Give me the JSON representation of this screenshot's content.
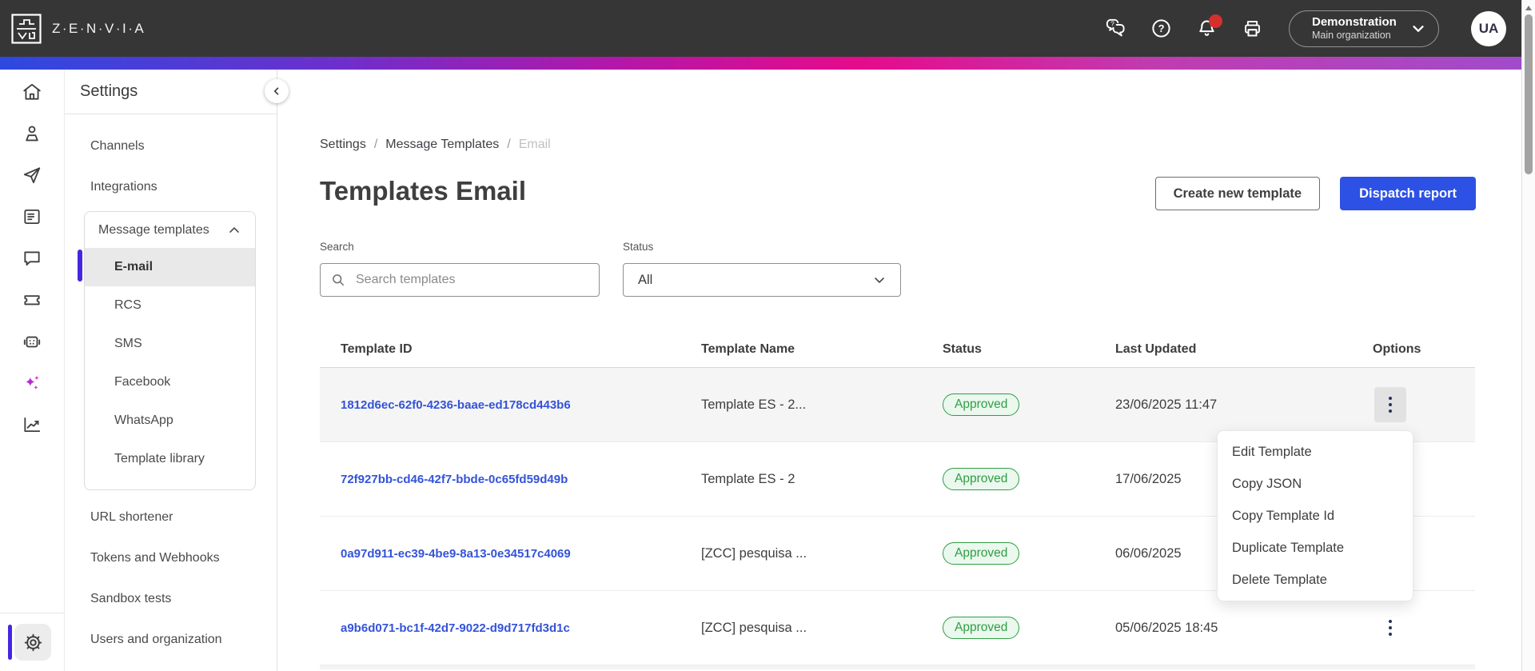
{
  "topbar": {
    "brand": "Z·E·N·V·I·A",
    "org_name": "Demonstration",
    "org_sub": "Main organization",
    "avatar_initials": "UA"
  },
  "sidebar": {
    "title": "Settings",
    "items_before": [
      "Channels",
      "Integrations"
    ],
    "group": {
      "label": "Message templates",
      "children": [
        "E-mail",
        "RCS",
        "SMS",
        "Facebook",
        "WhatsApp",
        "Template library"
      ],
      "selected": "E-mail"
    },
    "items_after": [
      "URL shortener",
      "Tokens and Webhooks",
      "Sandbox tests",
      "Users and organization"
    ]
  },
  "main": {
    "breadcrumb": {
      "level1": "Settings",
      "level2": "Message Templates",
      "current": "Email",
      "separator": "/"
    },
    "title": "Templates Email",
    "create_button": "Create new template",
    "dispatch_button": "Dispatch report",
    "filters": {
      "search_label": "Search",
      "search_placeholder": "Search templates",
      "status_label": "Status",
      "status_value": "All"
    },
    "table": {
      "headers": {
        "id": "Template ID",
        "name": "Template Name",
        "status": "Status",
        "updated": "Last Updated",
        "options": "Options"
      },
      "rows": [
        {
          "id": "1812d6ec-62f0-4236-baae-ed178cd443b6",
          "name": "Template ES - 2...",
          "status": "Approved",
          "updated": "23/06/2025 11:47"
        },
        {
          "id": "72f927bb-cd46-42f7-bbde-0c65fd59d49b",
          "name": "Template ES - 2",
          "status": "Approved",
          "updated": "17/06/2025"
        },
        {
          "id": "0a97d911-ec39-4be9-8a13-0e34517c4069",
          "name": "[ZCC] pesquisa ...",
          "status": "Approved",
          "updated": "06/06/2025"
        },
        {
          "id": "a9b6d071-bc1f-42d7-9022-d9d717fd3d1c",
          "name": "[ZCC] pesquisa ...",
          "status": "Approved",
          "updated": "05/06/2025 18:45"
        }
      ]
    },
    "context_menu": {
      "items": [
        "Edit Template",
        "Copy JSON",
        "Copy Template Id",
        "Duplicate Template",
        "Delete Template"
      ]
    }
  },
  "colors": {
    "topbar_bg": "#363636",
    "accent_blue": "#2d51e4",
    "link_blue": "#3353d9",
    "active_indigo": "#4527e0",
    "badge_green": "#2f9e44",
    "badge_green_bg": "#eaf8ee",
    "notification_red": "#d5302c",
    "gradient": [
      "#2c49e0",
      "#b317a9",
      "#e50b8b",
      "#a04ccb"
    ]
  }
}
